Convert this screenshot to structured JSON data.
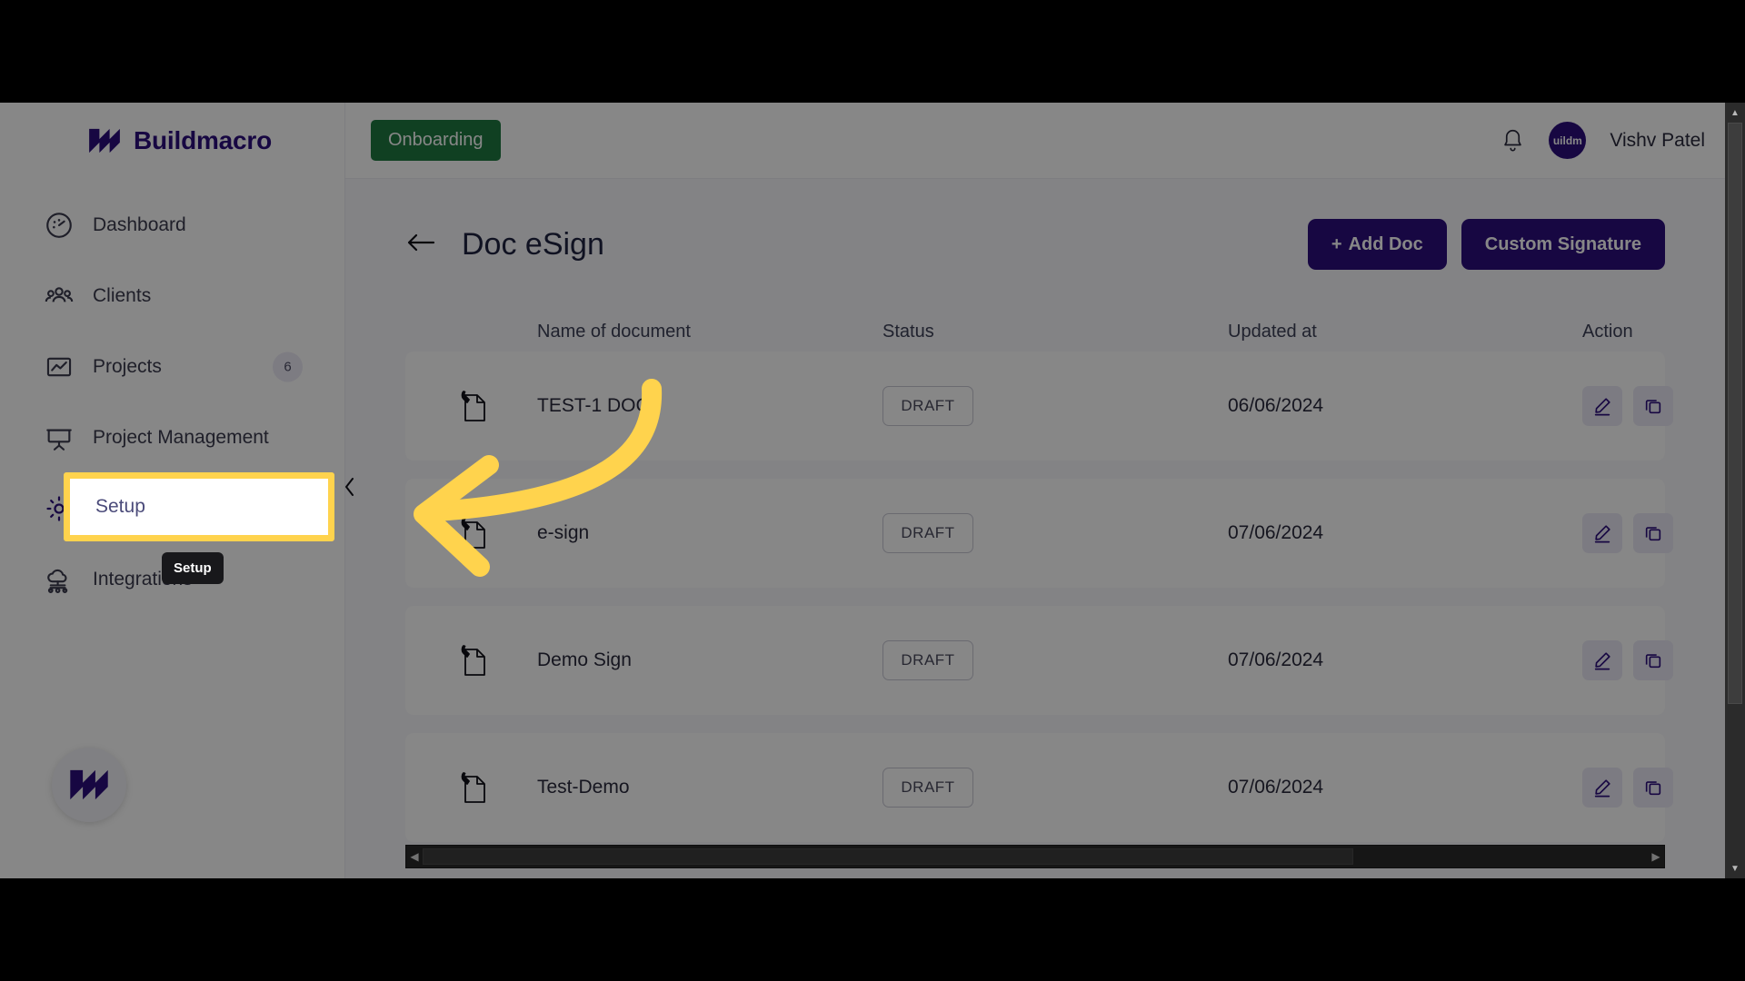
{
  "brand": {
    "name": "Buildmacro",
    "logo_icon": "buildmacro-m-logo"
  },
  "sidebar": {
    "items": [
      {
        "label": "Dashboard",
        "icon": "dashboard-gauge-icon",
        "badge": null
      },
      {
        "label": "Clients",
        "icon": "clients-people-icon",
        "badge": null
      },
      {
        "label": "Projects",
        "icon": "projects-chart-icon",
        "badge": "6"
      },
      {
        "label": "Project Management",
        "icon": "project-management-board-icon",
        "badge": null
      },
      {
        "label": "Setup",
        "icon": "settings-gear-icon",
        "badge": null
      },
      {
        "label": "Integrations",
        "icon": "integrations-cloud-icon",
        "badge": null
      }
    ],
    "collapse_icon": "chevron-left-icon",
    "bottom_logo_icon": "buildmacro-m-logo"
  },
  "topbar": {
    "onboarding_label": "Onboarding",
    "bell_icon": "notification-bell-icon",
    "avatar_text": "uildm",
    "user_name": "Vishv Patel"
  },
  "page": {
    "back_icon": "arrow-left-icon",
    "title": "Doc eSign",
    "add_doc_label": "Add Doc",
    "add_doc_plus": "+",
    "custom_signature_label": "Custom Signature"
  },
  "table": {
    "columns": [
      "",
      "Name of document",
      "Status",
      "Updated at",
      "Action"
    ],
    "rows": [
      {
        "icon": "document-sign-icon",
        "name": "TEST-1 DOC",
        "status": "DRAFT",
        "updated_at": "06/06/2024",
        "edit_icon": "edit-pencil-icon",
        "copy_icon": "copy-duplicate-icon"
      },
      {
        "icon": "document-sign-icon",
        "name": "e-sign",
        "status": "DRAFT",
        "updated_at": "07/06/2024",
        "edit_icon": "edit-pencil-icon",
        "copy_icon": "copy-duplicate-icon"
      },
      {
        "icon": "document-sign-icon",
        "name": "Demo Sign",
        "status": "DRAFT",
        "updated_at": "07/06/2024",
        "edit_icon": "edit-pencil-icon",
        "copy_icon": "copy-duplicate-icon"
      },
      {
        "icon": "document-sign-icon",
        "name": "Test-Demo",
        "status": "DRAFT",
        "updated_at": "07/06/2024",
        "edit_icon": "edit-pencil-icon",
        "copy_icon": "copy-duplicate-icon"
      }
    ]
  },
  "annotation": {
    "highlight_target_label": "Setup",
    "tooltip_text": "Setup",
    "highlight_color": "#ffd34d",
    "arrow_color": "#ffd34d",
    "arrow_icon": "curved-left-arrow-annotation"
  },
  "scrollbars": {
    "h_left_arrow": "◀",
    "h_right_arrow": "▶",
    "v_up_arrow": "▲",
    "v_down_arrow": "▼"
  },
  "colors": {
    "brand_purple": "#2d0f7e",
    "onboarding_green": "#1f7a41",
    "highlight_yellow": "#ffd34d",
    "page_bg": "#f7f7fb"
  }
}
